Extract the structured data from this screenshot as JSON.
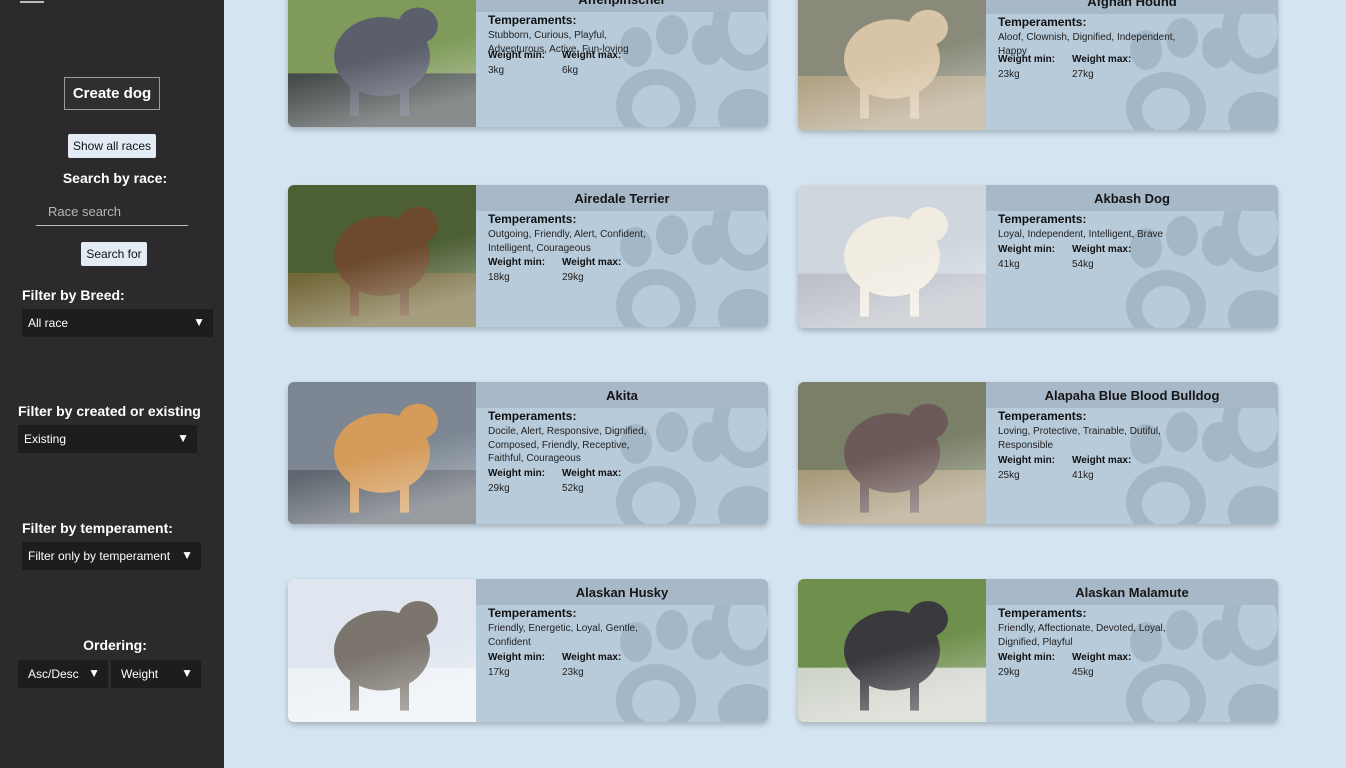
{
  "sidebar": {
    "create_label": "Create dog",
    "show_all_label": "Show all races",
    "search_label": "Search by race:",
    "search_placeholder": "Race search",
    "search_button": "Search for",
    "breed_label": "Filter by Breed:",
    "breed_value": "All race",
    "created_label": "Filter by created or existing",
    "created_value": "Existing",
    "temperament_label": "Filter by temperament:",
    "temperament_value": "Filter only by temperament",
    "ordering_label": "Ordering:",
    "order_dir_value": "Asc/Desc",
    "order_by_value": "Weight",
    "caret": "▼"
  },
  "card_labels": {
    "temperaments": "Temperaments:",
    "weight_min": "Weight min:",
    "weight_max": "Weight max:"
  },
  "cards": [
    {
      "name": "Affenpinscher",
      "temperament": "Stubborn, Curious, Playful, Adventurous, Active, Fun-loving",
      "weight_min": "3kg",
      "weight_max": "6kg"
    },
    {
      "name": "Afghan Hound",
      "temperament": "Aloof, Clownish, Dignified, Independent, Happy",
      "weight_min": "23kg",
      "weight_max": "27kg"
    },
    {
      "name": "Airedale Terrier",
      "temperament": "Outgoing, Friendly, Alert, Confident, Intelligent, Courageous",
      "weight_min": "18kg",
      "weight_max": "29kg"
    },
    {
      "name": "Akbash Dog",
      "temperament": "Loyal, Independent, Intelligent, Brave",
      "weight_min": "41kg",
      "weight_max": "54kg"
    },
    {
      "name": "Akita",
      "temperament": "Docile, Alert, Responsive, Dignified, Composed, Friendly, Receptive, Faithful, Courageous",
      "weight_min": "29kg",
      "weight_max": "52kg"
    },
    {
      "name": "Alapaha Blue Blood Bulldog",
      "temperament": "Loving, Protective, Trainable, Dutiful, Responsible",
      "weight_min": "25kg",
      "weight_max": "41kg"
    },
    {
      "name": "Alaskan Husky",
      "temperament": "Friendly, Energetic, Loyal, Gentle, Confident",
      "weight_min": "17kg",
      "weight_max": "23kg"
    },
    {
      "name": "Alaskan Malamute",
      "temperament": "Friendly, Affectionate, Devoted, Loyal, Dignified, Playful",
      "weight_min": "29kg",
      "weight_max": "45kg"
    }
  ]
}
